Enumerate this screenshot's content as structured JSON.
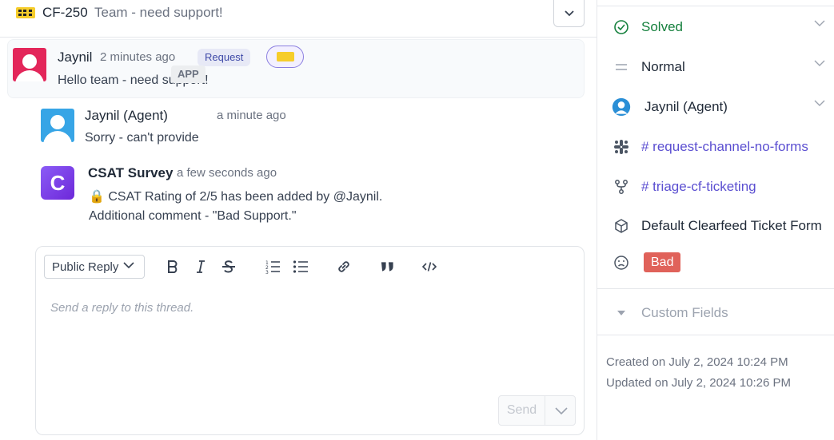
{
  "header": {
    "ticket_id": "CF-250",
    "ticket_title": "Team - need support!"
  },
  "messages": [
    {
      "author": "Jaynil",
      "time": "2 minutes ago",
      "badge": "Request",
      "text": "Hello team - need support!"
    },
    {
      "author": "Jaynil (Agent)",
      "time": "a minute ago",
      "badge": "APP",
      "text": "Sorry - can't provide"
    },
    {
      "author": "CSAT Survey",
      "time": "a few seconds ago",
      "avatar_letter": "C",
      "text_line1": "🔒 CSAT Rating of 2/5 has been added by @Jaynil.",
      "text_line2": "Additional comment - \"Bad Support.\""
    }
  ],
  "composer": {
    "reply_type": "Public Reply",
    "placeholder": "Send a reply to this thread.",
    "send_label": "Send",
    "tools": [
      "bold-icon",
      "italic-icon",
      "strikethrough-icon",
      "ordered-list-icon",
      "bullet-list-icon",
      "link-icon",
      "quote-icon",
      "code-icon"
    ]
  },
  "sidebar": {
    "status": "Solved",
    "priority": "Normal",
    "assignee": "Jaynil (Agent)",
    "channel_1": "# request-channel-no-forms",
    "channel_2": "# triage-cf-ticketing",
    "form": "Default Clearfeed Ticket Form",
    "csat": "Bad",
    "custom_fields_label": "Custom Fields",
    "created": "Created on July 2, 2024 10:24 PM",
    "updated": "Updated on July 2, 2024 10:26 PM"
  },
  "colors": {
    "accent_link": "#5b4fd1",
    "solved_green": "#15803d",
    "bad_red": "#e0625a",
    "request_badge_bg": "#e7e9f6"
  }
}
